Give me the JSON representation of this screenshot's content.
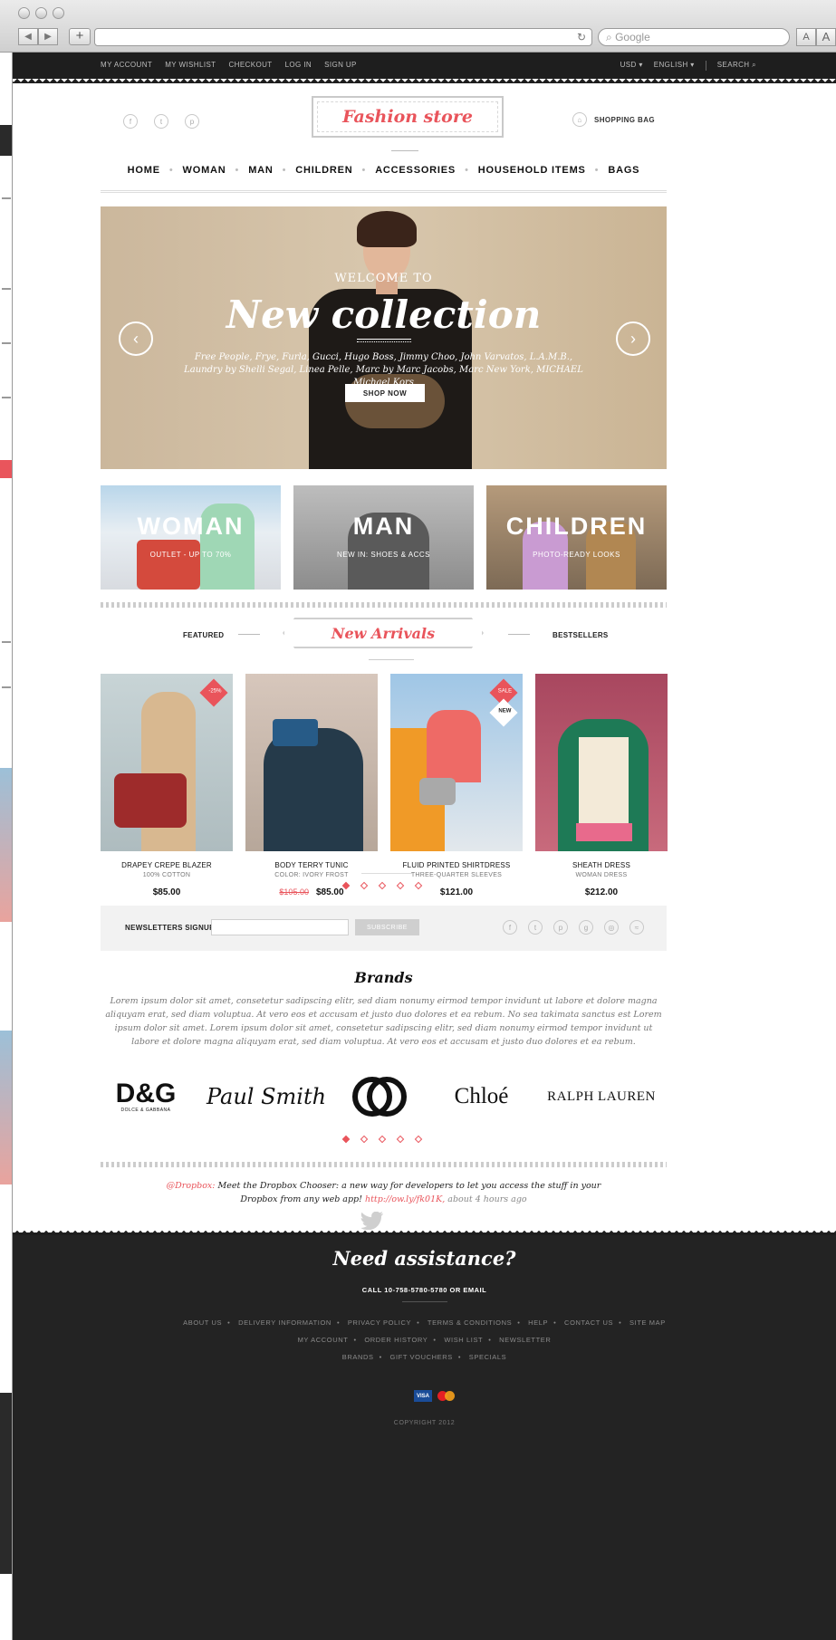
{
  "browser": {
    "search_placeholder": "Google",
    "font_small": "A",
    "font_large": "A"
  },
  "topbar": {
    "links": [
      "MY ACCOUNT",
      "MY WISHLIST",
      "CHECKOUT",
      "LOG IN",
      "SIGN UP"
    ],
    "currency": "USD ▾",
    "language": "ENGLISH ▾",
    "search": "SEARCH"
  },
  "header": {
    "logo": "Fashion store",
    "shopping_bag": "SHOPPING BAG"
  },
  "nav": [
    "HOME",
    "WOMAN",
    "MAN",
    "CHILDREN",
    "ACCESSORIES",
    "HOUSEHOLD ITEMS",
    "BAGS"
  ],
  "hero": {
    "kicker": "WELCOME TO",
    "title": "New collection",
    "text": "Free People, Frye, Furla, Gucci, Hugo Boss, Jimmy Choo, John Varvatos, L.A.M.B., Laundry by Shelli Segal, Linea Pelle, Marc by Marc Jacobs, Marc New York, MICHAEL Michael Kors",
    "button": "SHOP NOW"
  },
  "categories": [
    {
      "title": "WOMAN",
      "subtitle": "OUTLET - UP TO 70%"
    },
    {
      "title": "MAN",
      "subtitle": "NEW IN: SHOES & ACCS"
    },
    {
      "title": "CHILDREN",
      "subtitle": "PHOTO-READY LOOKS"
    }
  ],
  "arrivals": {
    "left": "FEATURED",
    "title": "New Arrivals",
    "right": "BESTSELLERS"
  },
  "products": [
    {
      "name": "DRAPEY CREPE BLAZER",
      "sub": "100% COTTON",
      "price": "$85.00",
      "badge": "-25%"
    },
    {
      "name": "BODY TERRY TUNIC",
      "sub": "COLOR: IVORY FROST",
      "old_price": "$105.00",
      "price": "$85.00"
    },
    {
      "name": "FLUID PRINTED SHIRTDRESS",
      "sub": "THREE-QUARTER SLEEVES",
      "price": "$121.00",
      "badge": "SALE",
      "badge2": "NEW"
    },
    {
      "name": "SHEATH DRESS",
      "sub": "WOMAN DRESS",
      "price": "$212.00"
    }
  ],
  "newsletter": {
    "label": "NEWSLETTERS SIGNUP",
    "button": "SUBSCRIBE"
  },
  "brands": {
    "title": "Brands",
    "text": "Lorem ipsum dolor sit amet, consetetur sadipscing elitr, sed diam nonumy eirmod tempor invidunt ut labore et dolore magna aliquyam erat, sed diam voluptua. At vero eos et accusam et justo duo dolores et ea rebum. No sea takimata sanctus est Lorem ipsum dolor sit amet. Lorem ipsum dolor sit amet, consetetur sadipscing elitr, sed diam nonumy eirmod tempor invidunt ut labore et dolore magna aliquyam erat, sed diam voluptua. At vero eos et accusam et justo duo dolores et ea rebum.",
    "logos": [
      "D&G",
      "DOLCE & GABBANA",
      "Paul Smith",
      "Chloé",
      "RALPH LAUREN"
    ]
  },
  "tweet": {
    "handle": "@Dropbox:",
    "text": "Meet the Dropbox Chooser: a new way for developers to let you access the stuff in your Dropbox from any web app!",
    "link": "http://ow.ly/fk01K,",
    "time": "about 4 hours ago"
  },
  "footer": {
    "title": "Need assistance?",
    "call": "CALL 10-758-5780-5780 OR EMAIL",
    "row1": [
      "ABOUT US",
      "DELIVERY INFORMATION",
      "PRIVACY POLICY",
      "TERMS & CONDITIONS",
      "HELP",
      "CONTACT US",
      "SITE MAP"
    ],
    "row2": [
      "MY ACCOUNT",
      "ORDER HISTORY",
      "WISH LIST",
      "NEWSLETTER"
    ],
    "row3": [
      "BRANDS",
      "GIFT VOUCHERS",
      "SPECIALS"
    ],
    "visa": "VISA",
    "copyright": "COPYRIGHT 2012"
  },
  "colors": {
    "accent": "#e9545b",
    "dark": "#232323"
  }
}
